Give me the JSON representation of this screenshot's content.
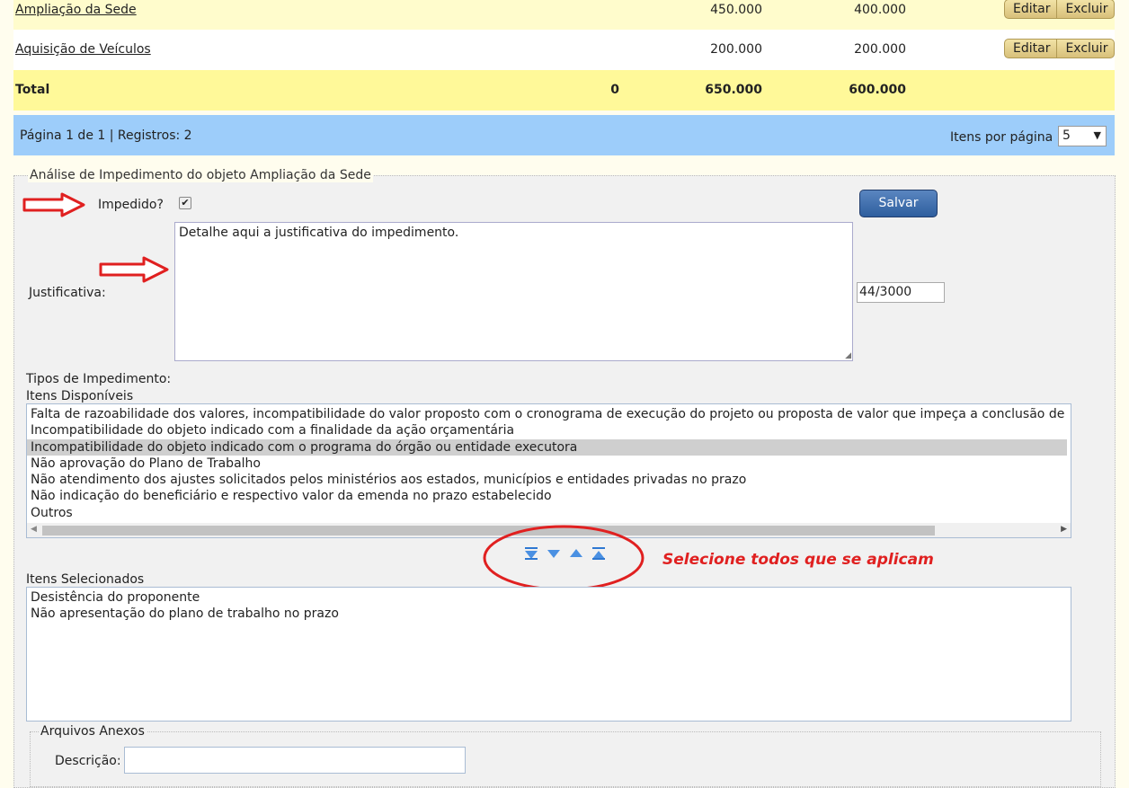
{
  "table": {
    "rows": [
      {
        "name": "Ampliação da Sede",
        "v1": "450.000",
        "v2": "400.000"
      },
      {
        "name": "Aquisição de Veículos",
        "v1": "200.000",
        "v2": "200.000"
      }
    ],
    "edit_label": "Editar",
    "delete_label": "Excluir",
    "total": {
      "label": "Total",
      "v0": "0",
      "v1": "650.000",
      "v2": "600.000"
    }
  },
  "pager": {
    "info": "Página 1 de 1 | Registros: 2",
    "per_page_label": "Itens por página",
    "per_page_value": "5"
  },
  "analysis": {
    "legend": "Análise de Impedimento do objeto Ampliação da Sede",
    "impeded_label": "Impedido?",
    "save_label": "Salvar",
    "justification_label": "Justificativa:",
    "justification_text": "Detalhe aqui a justificativa do impedimento.",
    "char_count": "44/3000",
    "types_label": "Tipos de Impedimento:",
    "available_label": "Itens Disponíveis",
    "available_items": [
      "Falta de razoabilidade dos valores, incompatibilidade do valor proposto com o cronograma de execução do projeto ou proposta de valor que impeça a conclusão de uma",
      "Incompatibilidade do objeto indicado com a finalidade da ação orçamentária",
      "Incompatibilidade do objeto indicado com o programa do órgão ou entidade executora",
      "Não aprovação do Plano de Trabalho",
      "Não atendimento dos ajustes solicitados pelos ministérios aos estados, municípios e entidades privadas no prazo",
      "Não indicação do beneficiário e respectivo valor da emenda no prazo estabelecido",
      "Outros"
    ],
    "annotation": "Selecione todos que se aplicam",
    "selected_label": "Itens Selecionados",
    "selected_items": [
      "Desistência do proponente",
      "Não apresentação do plano de trabalho no prazo"
    ],
    "attachments_legend": "Arquivos Anexos",
    "description_label": "Descrição:"
  },
  "colors": {
    "annotation": "#e02020",
    "save": "#2e5e9e",
    "pager": "#9dcdfa",
    "total_row": "#fff999"
  }
}
